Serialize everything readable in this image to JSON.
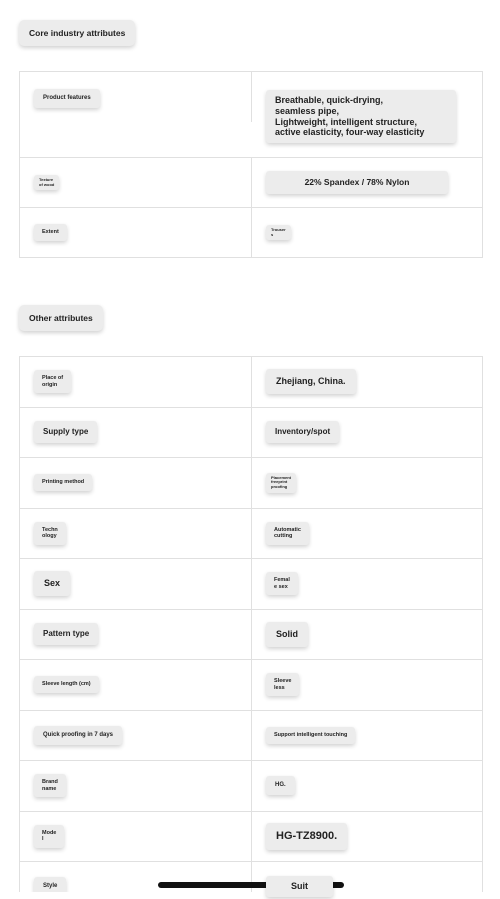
{
  "core_section": {
    "title": "Core industry attributes",
    "rows": [
      {
        "label": "Product features",
        "value": "Breathable, quick-drying,\nseamless pipe,\nLightweight, intelligent structure,\nactive elasticity, four-way elasticity"
      },
      {
        "label": "Texture\nof wood",
        "value": "22% Spandex / 78% Nylon"
      },
      {
        "label": "Extent",
        "value": "Trouser\ns"
      }
    ]
  },
  "other_section": {
    "title": "Other attributes",
    "rows": [
      {
        "label": "Place of\norigin",
        "value": "Zhejiang, China."
      },
      {
        "label": "Supply type",
        "value": "Inventory/spot"
      },
      {
        "label": "Printing method",
        "value": "Placement\nfreeprint\nproofing"
      },
      {
        "label": "Techn\nology",
        "value": "Automatic\ncutting"
      },
      {
        "label": "Sex",
        "value": "Femal\ne sex"
      },
      {
        "label": "Pattern type",
        "value": "Solid"
      },
      {
        "label": "Sleeve length (cm)",
        "value": "Sleeve\nless"
      },
      {
        "label": "Quick proofing in 7 days",
        "value": "Support intelligent touching"
      },
      {
        "label": "Brand\nname",
        "value": "HG."
      },
      {
        "label": "Mode\nl",
        "value": "HG-TZ8900."
      },
      {
        "label": "Style",
        "value": "Suit"
      }
    ]
  }
}
